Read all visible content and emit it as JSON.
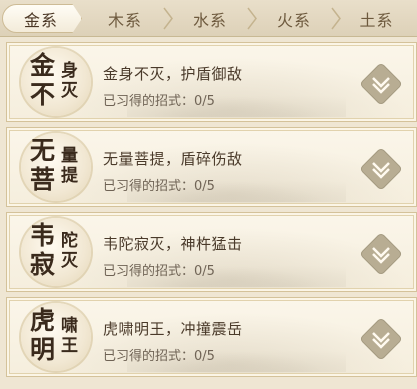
{
  "tabs": [
    {
      "label": "金系",
      "active": true
    },
    {
      "label": "木系",
      "active": false
    },
    {
      "label": "水系",
      "active": false
    },
    {
      "label": "火系",
      "active": false
    },
    {
      "label": "土系",
      "active": false
    }
  ],
  "skills": [
    {
      "emblem": [
        "金",
        "不",
        "身",
        "灭"
      ],
      "name": "金身不灭，护盾御敌",
      "progress": "已习得的招式：0/5"
    },
    {
      "emblem": [
        "无",
        "菩",
        "量",
        "提"
      ],
      "name": "无量菩提，盾碎伤敌",
      "progress": "已习得的招式：0/5"
    },
    {
      "emblem": [
        "韦",
        "寂",
        "陀",
        "灭"
      ],
      "name": "韦陀寂灭，神杵猛击",
      "progress": "已习得的招式：0/5"
    },
    {
      "emblem": [
        "虎",
        "明",
        "啸",
        "王"
      ],
      "name": "虎啸明王，冲撞震岳",
      "progress": "已习得的招式：0/5"
    }
  ],
  "icons": {
    "expand": "chevron-down-diamond-icon",
    "emblem": "calligraphy-emblem-icon"
  },
  "colors": {
    "background": "#efe6d3",
    "expand_button": "#b8ad93",
    "border": "#d4c29a"
  }
}
